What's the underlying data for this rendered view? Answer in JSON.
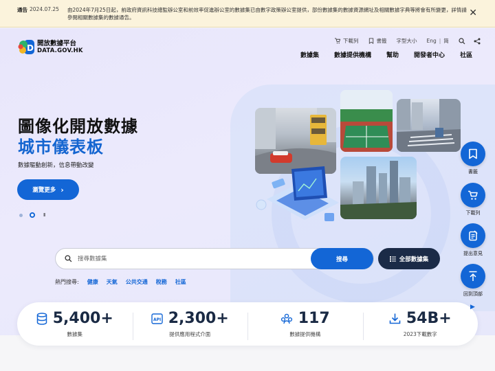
{
  "notice": {
    "label": "通告",
    "date": "2024.07.25",
    "text": "由2024年7月25日起，前政府資訊科技總監辦公室和前效率促進辦公室的數據集已由數字政策辦公室提供，部份數據集的數據資源網址及相關數據字典等將會有所變更，詳情請參閱相關數據集的數據通告。",
    "close_icon": "close-icon"
  },
  "logo": {
    "name_zh": "開放數據平台",
    "name_en": "DATA.GOV.HK"
  },
  "utility": {
    "download_list": "下載列",
    "bookmarks": "書籤",
    "font_size": "字型大小",
    "lang_en": "Eng",
    "lang_sep": "|",
    "lang_sc": "简"
  },
  "nav": {
    "items": [
      "數據集",
      "數據提供機構",
      "幫助",
      "開發者中心",
      "社區"
    ]
  },
  "hero": {
    "title": "圖像化開放數據",
    "subtitle": "城市儀表板",
    "description": "數據驅動創新，信息帶動改變",
    "browse_button": "瀏覽更多",
    "pause": "II"
  },
  "search": {
    "placeholder": "搜尋數據集",
    "button": "搜尋",
    "all_datasets": "全部數據集"
  },
  "hot_search": {
    "label": "熱門搜尋:",
    "tags": [
      "健康",
      "天氣",
      "公共交通",
      "稅務",
      "社區"
    ]
  },
  "side_tools": [
    {
      "label": "書籤",
      "icon": "bookmark-icon"
    },
    {
      "label": "下載列",
      "icon": "cart-icon"
    },
    {
      "label": "提出意見",
      "icon": "feedback-icon"
    },
    {
      "label": "回到頂部",
      "icon": "back-to-top-icon"
    }
  ],
  "stats": [
    {
      "value": "5,400+",
      "label": "數據集",
      "icon": "database-icon"
    },
    {
      "value": "2,300+",
      "label": "提供應用程式介面",
      "icon": "api-icon"
    },
    {
      "value": "117",
      "label": "數據提供機構",
      "icon": "organization-icon"
    },
    {
      "value": "54B+",
      "label": "2023下載數字",
      "icon": "download-icon"
    }
  ],
  "colors": {
    "primary": "#1366d6",
    "dark_button": "#1b2b47",
    "notice_bg": "#fbf3dc",
    "hero_bg": "#eceafc"
  }
}
